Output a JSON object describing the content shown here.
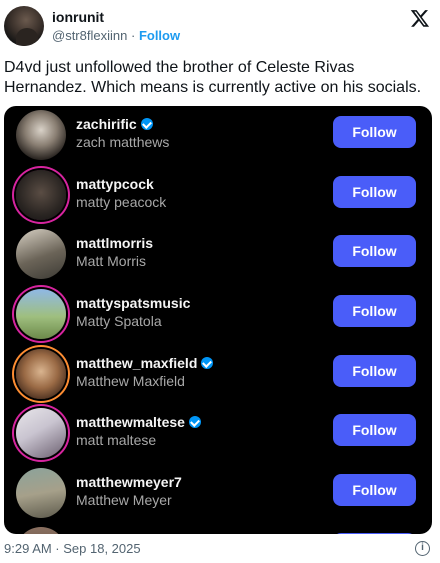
{
  "post": {
    "author_name": "ionrunit",
    "handle": "@str8flexiinn",
    "separator": "·",
    "follow_label": "Follow",
    "text": "D4vd just unfollowed the brother of Celeste Rivas Hernandez. Which means is currently active on his socials.",
    "timestamp": "9:29 AM · Sep 18, 2025"
  },
  "list": {
    "button_label": "Follow",
    "items": [
      {
        "username": "zachirific",
        "name": "zach matthews",
        "verified": true
      },
      {
        "username": "mattypcock",
        "name": "matty peacock",
        "verified": false
      },
      {
        "username": "mattlmorris",
        "name": "Matt Morris",
        "verified": false
      },
      {
        "username": "mattyspatsmusic",
        "name": "Matty Spatola",
        "verified": false
      },
      {
        "username": "matthew_maxfield",
        "name": "Matthew Maxfield",
        "verified": true
      },
      {
        "username": "matthewmaltese",
        "name": "matt maltese",
        "verified": true
      },
      {
        "username": "matthewmeyer7",
        "name": "Matthew Meyer",
        "verified": false
      }
    ]
  },
  "icons": {
    "x_logo": "x-logo-icon",
    "info": "info-icon"
  },
  "colors": {
    "follow_link": "#1d9bf0",
    "follow_button": "#4a5df9",
    "media_bg": "#000000",
    "verified_badge": "#0095f6"
  }
}
